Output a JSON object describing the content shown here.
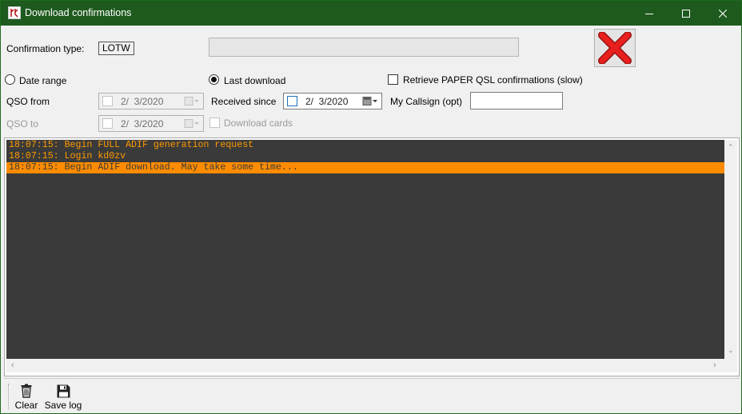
{
  "window": {
    "title": "Download confirmations",
    "app_icon": "app-icon",
    "controls": [
      "minimize-icon",
      "maximize-icon",
      "close-icon"
    ]
  },
  "confirmation": {
    "label": "Confirmation type:",
    "value": "LOTW",
    "field_value": ""
  },
  "cancel_button": {
    "icon": "red-x-icon",
    "color": "#e8201d"
  },
  "options": {
    "date_range": {
      "label": "Date range",
      "checked": false
    },
    "last_download": {
      "label": "Last download",
      "checked": true
    },
    "retrieve_paper": {
      "label": "Retrieve PAPER QSL confirmations (slow)",
      "checked": false
    }
  },
  "qso_from": {
    "label": "QSO from",
    "value": "2/  3/2020",
    "enabled": false
  },
  "qso_to": {
    "label": "QSO to",
    "value": "2/  3/2020",
    "enabled": false
  },
  "received_since": {
    "label": "Received since",
    "value": "2/  3/2020",
    "enabled": true
  },
  "my_callsign": {
    "label": "My Callsign (opt)",
    "value": ""
  },
  "download_cards": {
    "label": "Download cards",
    "checked": false,
    "enabled": false
  },
  "log": {
    "lines": [
      {
        "text": "18:07:15: Begin FULL ADIF generation request",
        "selected": false
      },
      {
        "text": "18:07:15: Login kd0zv",
        "selected": false
      },
      {
        "text": "18:07:15: Begin ADIF download. May take some time...",
        "selected": true
      }
    ],
    "colors": {
      "background": "#3a3a3a",
      "text": "#ff9a00",
      "selection": "#ff8c00"
    }
  },
  "toolbar": {
    "clear": {
      "label": "Clear",
      "icon": "trash-icon"
    },
    "save_log": {
      "label": "Save log",
      "icon": "floppy-disk-icon"
    }
  },
  "colors": {
    "titlebar": "#1e5a1e",
    "window_bg": "#f0f0f0"
  }
}
